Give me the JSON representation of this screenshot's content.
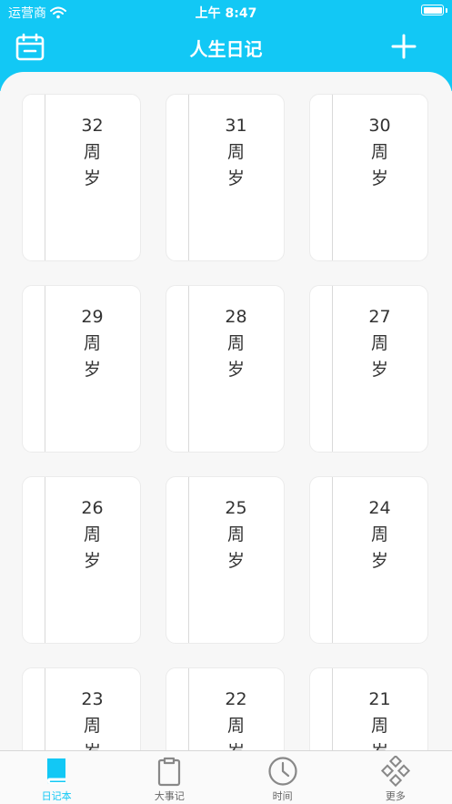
{
  "status_bar": {
    "carrier": "运营商",
    "time": "上午 8:47"
  },
  "header": {
    "title": "人生日记",
    "left_icon": "calendar-icon",
    "right_icon": "plus-icon"
  },
  "diaries": [
    {
      "number": "32",
      "line1": "周",
      "line2": "岁"
    },
    {
      "number": "31",
      "line1": "周",
      "line2": "岁"
    },
    {
      "number": "30",
      "line1": "周",
      "line2": "岁"
    },
    {
      "number": "29",
      "line1": "周",
      "line2": "岁"
    },
    {
      "number": "28",
      "line1": "周",
      "line2": "岁"
    },
    {
      "number": "27",
      "line1": "周",
      "line2": "岁"
    },
    {
      "number": "26",
      "line1": "周",
      "line2": "岁"
    },
    {
      "number": "25",
      "line1": "周",
      "line2": "岁"
    },
    {
      "number": "24",
      "line1": "周",
      "line2": "岁"
    },
    {
      "number": "23",
      "line1": "周",
      "line2": "岁"
    },
    {
      "number": "22",
      "line1": "周",
      "line2": "岁"
    },
    {
      "number": "21",
      "line1": "周",
      "line2": "岁"
    }
  ],
  "tabs": [
    {
      "label": "日记本",
      "icon": "book-icon",
      "active": true
    },
    {
      "label": "大事记",
      "icon": "clipboard-icon",
      "active": false
    },
    {
      "label": "时间",
      "icon": "clock-icon",
      "active": false
    },
    {
      "label": "更多",
      "icon": "diamond-grid-icon",
      "active": false
    }
  ],
  "colors": {
    "accent": "#12c8f5",
    "tab_inactive": "#666666",
    "background": "#f7f7f7"
  }
}
